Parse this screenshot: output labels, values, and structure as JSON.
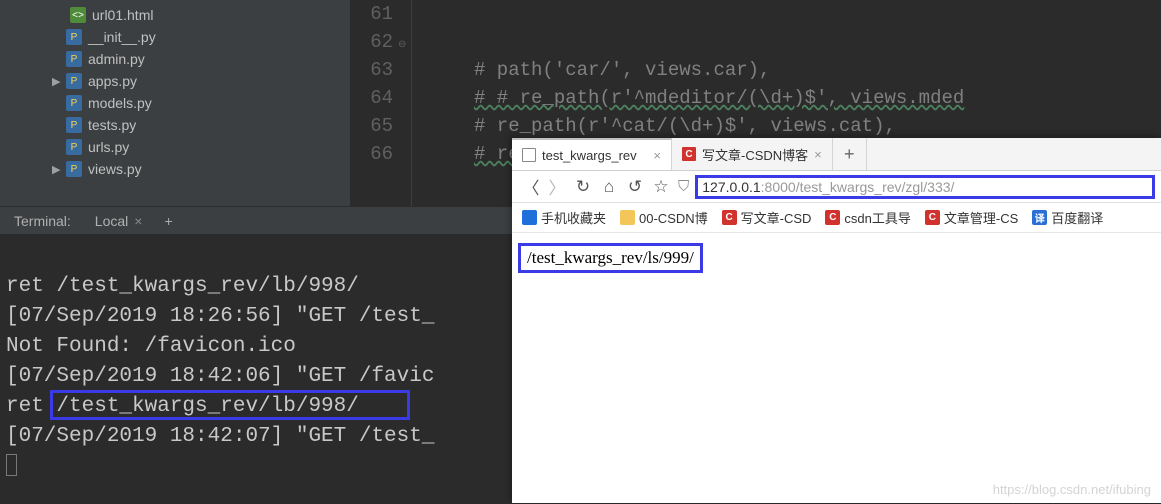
{
  "tree": {
    "files": [
      {
        "name": "url01.html",
        "kind": "html",
        "depth": 3
      },
      {
        "name": "__init__.py",
        "kind": "py",
        "depth": 2
      },
      {
        "name": "admin.py",
        "kind": "py",
        "depth": 2
      },
      {
        "name": "apps.py",
        "kind": "py",
        "depth": 2,
        "arrow": true
      },
      {
        "name": "models.py",
        "kind": "py",
        "depth": 2
      },
      {
        "name": "tests.py",
        "kind": "py",
        "depth": 2
      },
      {
        "name": "urls.py",
        "kind": "py",
        "depth": 2
      },
      {
        "name": "views.py",
        "kind": "py",
        "depth": 2,
        "arrow": true
      }
    ]
  },
  "editor": {
    "lines": [
      {
        "num": "61",
        "text": ""
      },
      {
        "num": "62",
        "text": "# path('car/', views.car),"
      },
      {
        "num": "63",
        "text": "# # re_path(r'^mdeditor/(\\d+)$', views.mded"
      },
      {
        "num": "64",
        "text": "# re_path(r'^cat/(\\d+)$', views.cat),"
      },
      {
        "num": "65",
        "text": "# re_path(r\"^mdeditor/articl_list/(\\d*)$\""
      },
      {
        "num": "66",
        "text": ""
      }
    ]
  },
  "terminal": {
    "title": "Terminal:",
    "tab": "Local",
    "out": [
      "ret /test_kwargs_rev/lb/998/",
      "[07/Sep/2019 18:26:56] \"GET /test_",
      "Not Found: /favicon.ico",
      "[07/Sep/2019 18:42:06] \"GET /favic",
      "ret /test_kwargs_rev/lb/998/",
      "[07/Sep/2019 18:42:07] \"GET /test_"
    ]
  },
  "browser": {
    "tabs": [
      {
        "title": "test_kwargs_rev",
        "active": true
      },
      {
        "title": "写文章-CSDN博客",
        "active": false
      }
    ],
    "url_host": "127.0.0.1",
    "url_rest": ":8000/test_kwargs_rev/zgl/333/",
    "bookmarks": [
      {
        "label": "手机收藏夹",
        "ico": "blue"
      },
      {
        "label": "00-CSDN博",
        "ico": "folder"
      },
      {
        "label": "写文章-CSD",
        "ico": "red",
        "ch": "C"
      },
      {
        "label": "csdn工具导",
        "ico": "red",
        "ch": "C"
      },
      {
        "label": "文章管理-CS",
        "ico": "red",
        "ch": "C"
      },
      {
        "label": "百度翻译",
        "ico": "tr",
        "ch": "译"
      }
    ],
    "page_text": "/test_kwargs_rev/ls/999/",
    "watermark": "https://blog.csdn.net/ifubing"
  }
}
